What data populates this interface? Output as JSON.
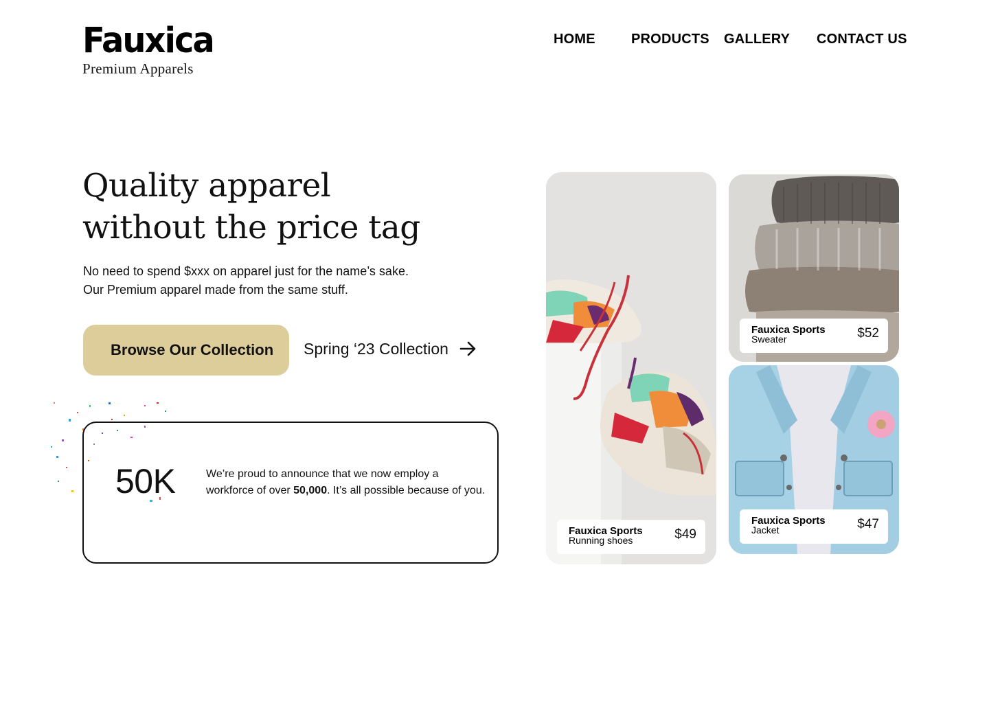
{
  "brand": {
    "logo": "Fauxica",
    "tagline": "Premium Apparels"
  },
  "nav": {
    "home": "HOME",
    "products": "PRODUCTS",
    "gallery": "GALLERY",
    "contact": "CONTACT US"
  },
  "hero": {
    "headline_line1": "Quality apparel",
    "headline_line2": "without the price tag",
    "subtext_line1": "No need to spend $xxx on apparel just for the name’s sake.",
    "subtext_line2": "Our Premium apparel made from the same stuff.",
    "cta_label": "Browse Our Collection",
    "secondary_label": "Spring ‘23 Collection",
    "secondary_icon": "arrow-right-icon"
  },
  "stats": {
    "number": "50K",
    "text_before": "We’re proud to announce that we now employ a workforce of over ",
    "text_bold": "50,000",
    "text_after": ". It’s all possible because of you."
  },
  "products": [
    {
      "brand": "Fauxica Sports",
      "name": "Running shoes",
      "price": "$49"
    },
    {
      "brand": "Fauxica Sports",
      "name": "Sweater",
      "price": "$52"
    },
    {
      "brand": "Fauxica Sports",
      "name": "Jacket",
      "price": "$47"
    }
  ],
  "colors": {
    "cta_background": "#dccd9a",
    "text": "#111111",
    "background": "#ffffff"
  }
}
